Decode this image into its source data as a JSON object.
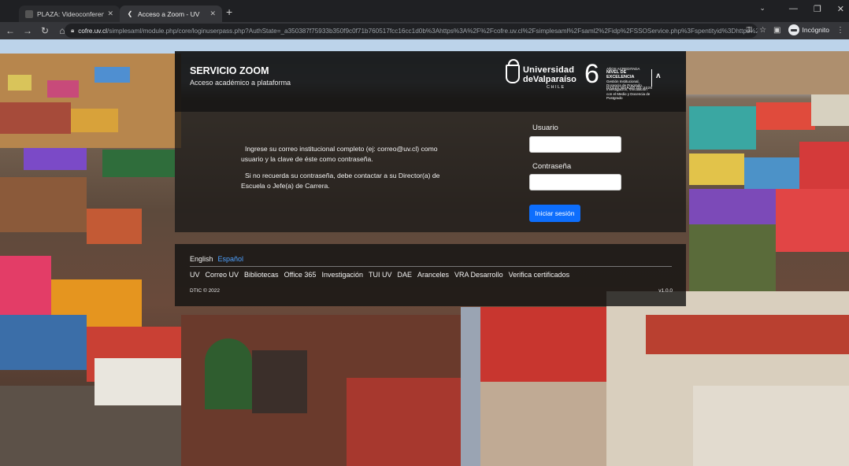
{
  "browser": {
    "tabs": [
      {
        "title": "PLAZA: Videoconferencia de esc",
        "active": false
      },
      {
        "title": "Acceso a Zoom - UV",
        "active": true
      }
    ],
    "new_tab": "+",
    "url_host": "cofre.uv.cl",
    "url_path": "/simplesaml/module.php/core/loginuserpass.php?AuthState=_a350387f75933b350f9c0f71b760517fcc16cc1d0b%3Ahttps%3A%2F%2Fcofre.uv.cl%2Fsimplesaml%2Fsaml2%2Fidp%2FSSOService.php%3Fspentityid%3Dhttps%253A%25...",
    "profile_label": "Incógnito"
  },
  "header": {
    "service_title": "SERVICIO ZOOM",
    "service_subtitle": "Acceso académico a plataforma",
    "uv_logo": {
      "line1": "Universidad",
      "line2": "deValparaíso",
      "line3": "CHILE"
    },
    "accreditation": {
      "years": "6",
      "line1": "AÑOS ACREDITADA",
      "line2": "NIVEL DE EXCELENCIA",
      "line3": "Gestión Institucional, Docencia de Pregrado, Investigación, Vinculación con el Medio y Docencia de Postgrado",
      "until": "HASTA MARZO DE 2028"
    }
  },
  "login": {
    "instructions": [
      "Ingrese su correo institucional completo (ej: correo@uv.cl) como usuario y la clave de éste como contraseña.",
      "Si no recuerda su contraseña, debe contactar a su Director(a) de Escuela o Jefe(a) de Carrera."
    ],
    "username_label": "Usuario",
    "username_value": "",
    "password_label": "Contraseña",
    "password_value": "",
    "submit_label": "Iniciar sesión",
    "accent_color": "#0d6efd"
  },
  "footer": {
    "languages": [
      {
        "label": "English",
        "selected": false
      },
      {
        "label": "Español",
        "selected": true
      }
    ],
    "links": [
      "UV",
      "Correo UV",
      "Bibliotecas",
      "Office 365",
      "Investigación",
      "TUI UV",
      "DAE",
      "Aranceles",
      "VRA Desarrollo",
      "Verifica certificados"
    ],
    "copyright": "DTIC © 2022",
    "version": "v1.0.0"
  }
}
